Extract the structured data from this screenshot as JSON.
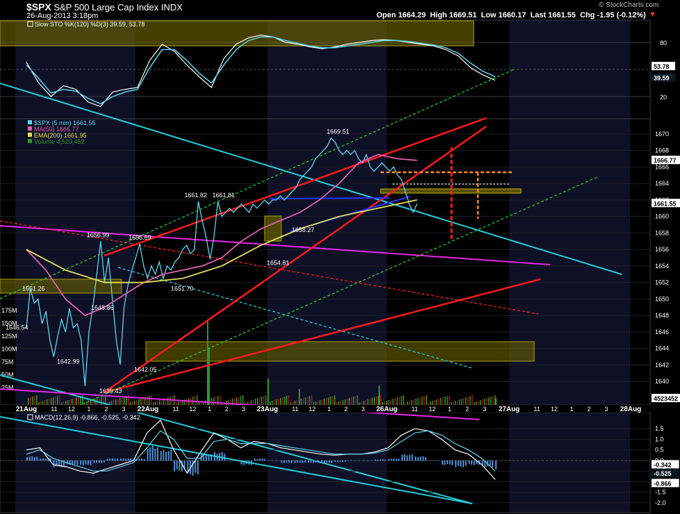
{
  "header": {
    "symbol": "$SPX",
    "name": "S&P 500 Large Cap Index",
    "exchange": "INDX",
    "datetime": "26-Aug-2013 3:18pm",
    "open_label": "Open",
    "open": "1664.29",
    "high_label": "High",
    "high": "1669.51",
    "low_label": "Low",
    "low": "1660.17",
    "last_label": "Last",
    "last": "1661.55",
    "chg_label": "Chg",
    "chg": "-1.95 (-0.12%)",
    "watermark": "© StockCharts.com"
  },
  "colors": {
    "price": "#5ad7f0",
    "ma50": "#e060b0",
    "ema200": "#e6e05a",
    "volume": "#2a9a2a",
    "trend_red": "#ff1a1a",
    "trend_cyan": "#20d0e0",
    "trend_magenta": "#ee22ee",
    "trend_green": "#22cc22",
    "zone": "#6a6200",
    "orange": "#ff8c1a",
    "blue": "#2233ff"
  },
  "chart_data": [
    {
      "type": "line",
      "panel": "sto",
      "title": "Slow STO %K(120) %D(3)",
      "legend_values": [
        "39.59",
        "53.78"
      ],
      "yticks": [
        "80",
        "20"
      ],
      "value_tags": [
        "53.78",
        "39.59"
      ],
      "ylim": [
        0,
        100
      ],
      "series": [
        {
          "name": "%K",
          "color": "#ffffff",
          "values": [
            58,
            35,
            20,
            32,
            28,
            14,
            9,
            25,
            28,
            30,
            60,
            78,
            70,
            55,
            42,
            30,
            62,
            78,
            85,
            88,
            86,
            80,
            78,
            75,
            73,
            75,
            78,
            80,
            82,
            83,
            82,
            80,
            78,
            76,
            72,
            65,
            52,
            44,
            38
          ]
        },
        {
          "name": "%D",
          "color": "#5ad7f0",
          "values": [
            55,
            40,
            24,
            28,
            26,
            18,
            12,
            20,
            25,
            28,
            52,
            72,
            72,
            60,
            46,
            35,
            55,
            72,
            82,
            86,
            86,
            82,
            79,
            76,
            74,
            74,
            76,
            78,
            80,
            82,
            82,
            81,
            79,
            77,
            74,
            68,
            57,
            48,
            42
          ]
        }
      ]
    },
    {
      "type": "line",
      "panel": "price",
      "legend": [
        {
          "text": "$SPX (5 min) 1661.55",
          "color": "#5ad7f0"
        },
        {
          "text": "MA(50) 1666.77",
          "color": "#e060b0"
        },
        {
          "text": "EMA(200) 1661.95",
          "color": "#e6e05a"
        },
        {
          "text": "Volume 4,523,452",
          "color": "#2a9a2a"
        }
      ],
      "ylim": [
        1638,
        1671
      ],
      "yticks": [
        "1670",
        "1668",
        "1666",
        "1664",
        "1662",
        "1660",
        "1658",
        "1656",
        "1654",
        "1652",
        "1650",
        "1648",
        "1646",
        "1644",
        "1642",
        "1640"
      ],
      "volume_ticks": [
        "175M",
        "150M",
        "125M",
        "100M",
        "75M",
        "50M",
        "25M"
      ],
      "value_tags": [
        "1666.77",
        "1661.55",
        "4523452"
      ],
      "annotations": [
        "1669.51",
        "1661.82",
        "1661.81",
        "1658.27",
        "1656.99",
        "1656.69",
        "1654.81",
        "1651.26",
        "1651.70",
        "1648.86",
        "1646.54",
        "1642.99",
        "1642.05",
        "1639.43"
      ],
      "series": [
        {
          "name": "$SPX",
          "x": [
            0,
            2,
            4,
            6,
            8,
            10,
            12,
            14,
            16,
            18,
            20,
            22,
            24,
            26,
            28,
            30,
            32,
            34,
            36,
            38,
            40,
            42,
            44,
            46,
            48,
            50,
            52,
            54,
            56,
            58,
            60,
            62,
            64,
            66,
            68,
            70,
            72,
            74,
            76,
            78,
            80,
            82,
            84,
            86,
            88,
            90,
            92,
            94,
            96,
            98,
            100,
            102,
            104,
            106,
            108,
            110,
            112,
            114,
            116,
            118,
            120,
            122,
            124,
            126,
            128,
            130,
            132,
            134,
            136,
            138,
            140,
            142,
            144,
            146,
            148,
            150,
            152,
            154,
            156,
            158,
            160,
            162,
            164,
            166,
            168,
            170,
            172,
            174,
            176,
            178,
            180,
            182,
            184,
            186,
            188,
            190,
            192,
            194,
            196,
            198,
            200,
            202,
            204,
            206,
            208,
            210,
            212,
            214,
            216,
            218,
            220,
            222,
            224,
            226,
            228,
            230,
            232,
            234,
            236,
            238,
            240
          ],
          "values": [
            1646.5,
            1651.3,
            1649.5,
            1650.0,
            1647.0,
            1648.5,
            1645.0,
            1642.99,
            1645.5,
            1647.5,
            1646.0,
            1648.86,
            1646.5,
            1647.0,
            1645.0,
            1639.43,
            1646.0,
            1649.0,
            1653.0,
            1656.99,
            1652.0,
            1655.0,
            1650.0,
            1645.0,
            1642.05,
            1649.0,
            1651.7,
            1653.5,
            1655.0,
            1656.69,
            1654.0,
            1652.5,
            1654.0,
            1653.0,
            1654.5,
            1652.5,
            1654.0,
            1653.5,
            1654.5,
            1655.0,
            1656.0,
            1656.5,
            1655.5,
            1656.0,
            1661.82,
            1659.5,
            1657.5,
            1654.81,
            1657.5,
            1661.81,
            1660.0,
            1660.5,
            1661.0,
            1660.5,
            1661.0,
            1661.5,
            1661.0,
            1660.5,
            1661.5,
            1661.0,
            1661.5,
            1662.0,
            1661.5,
            1662.0,
            1662.0,
            1662.5,
            1662.0,
            1662.5,
            1663.0,
            1663.5,
            1664.5,
            1665.0,
            1665.5,
            1666.0,
            1667.0,
            1667.5,
            1668.0,
            1668.5,
            1669.51,
            1669.0,
            1668.0,
            1667.5,
            1668.0,
            1667.5,
            1668.0,
            1667.0,
            1666.5,
            1667.5,
            1666.0,
            1665.5,
            1666.0,
            1666.5,
            1666.0,
            1665.5,
            1666.0,
            1665.0,
            1664.5,
            1663.0,
            1661.5,
            1660.5,
            1661.55,
            1661.55,
            1661.55,
            1661.55,
            1661.55,
            1661.55,
            1661.55,
            1661.55,
            1661.55,
            1661.55,
            1661.55,
            1661.55,
            1661.55,
            1661.55,
            1661.55,
            1661.55,
            1661.55,
            1661.55,
            1661.55,
            1661.55,
            1661.55
          ]
        },
        {
          "name": "MA(50)",
          "x": [
            0,
            10,
            20,
            30,
            40,
            50,
            60,
            70,
            80,
            90,
            100,
            110,
            120,
            130,
            140,
            150,
            160,
            170,
            180,
            190,
            200
          ],
          "values": [
            1656.0,
            1653.5,
            1650.0,
            1648.0,
            1649.0,
            1650.5,
            1652.0,
            1653.0,
            1653.5,
            1654.0,
            1655.0,
            1657.0,
            1658.5,
            1659.5,
            1660.5,
            1662.0,
            1664.0,
            1666.5,
            1667.5,
            1667.0,
            1666.8
          ]
        },
        {
          "name": "EMA(200)",
          "x": [
            0,
            20,
            40,
            60,
            80,
            100,
            120,
            140,
            160,
            180,
            200
          ],
          "values": [
            1656.0,
            1653.5,
            1652.0,
            1652.0,
            1652.5,
            1654.0,
            1656.5,
            1658.5,
            1660.0,
            1661.0,
            1662.0
          ]
        }
      ]
    },
    {
      "type": "line",
      "panel": "macd",
      "title": "MACD(12,26,9)",
      "legend_values": [
        "-0.866",
        "-0.525",
        "-0.342"
      ],
      "yticks": [
        "1.5",
        "1.0",
        "0.5",
        "0.0",
        "-0.5",
        "-1.0",
        "-1.5",
        "-2.0"
      ],
      "value_tags": [
        "-0.342",
        "-0.525",
        "-0.866"
      ],
      "ylim": [
        -2.2,
        2.0
      ],
      "series": [
        {
          "name": "MACD",
          "color": "#ffffff",
          "values": [
            0.5,
            0.6,
            -0.2,
            -0.3,
            -0.5,
            -0.6,
            -0.4,
            -0.2,
            0.0,
            1.3,
            1.9,
            0.5,
            -0.6,
            0.4,
            1.3,
            1.0,
            0.6,
            0.9,
            0.8,
            0.6,
            0.5,
            0.4,
            0.3,
            0.25,
            0.3,
            0.3,
            0.4,
            0.6,
            1.2,
            1.5,
            1.4,
            1.0,
            0.5,
            0.3,
            -0.2,
            -0.9
          ]
        },
        {
          "name": "Signal",
          "color": "#5ad7f0",
          "values": [
            0.3,
            0.5,
            0.1,
            -0.1,
            -0.3,
            -0.5,
            -0.5,
            -0.3,
            -0.1,
            0.6,
            1.4,
            1.0,
            0.1,
            0.1,
            0.9,
            1.0,
            0.8,
            0.8,
            0.8,
            0.7,
            0.6,
            0.5,
            0.4,
            0.3,
            0.3,
            0.3,
            0.35,
            0.5,
            0.9,
            1.3,
            1.4,
            1.2,
            0.8,
            0.5,
            0.1,
            -0.5
          ]
        },
        {
          "name": "Histogram",
          "color": "#4a90d9",
          "values": [
            0.2,
            0.1,
            -0.3,
            -0.2,
            -0.2,
            -0.1,
            0.1,
            0.1,
            0.1,
            0.7,
            0.5,
            -0.5,
            -0.7,
            0.3,
            0.4,
            0.0,
            -0.2,
            0.1,
            0.0,
            -0.1,
            -0.1,
            -0.1,
            -0.1,
            -0.05,
            0.0,
            0.0,
            0.05,
            0.1,
            0.3,
            0.2,
            0.0,
            -0.2,
            -0.3,
            -0.2,
            -0.3,
            -0.4
          ]
        }
      ]
    }
  ],
  "x_axis": {
    "labels": [
      {
        "text": "21Aug",
        "bold": true
      },
      {
        "text": "11"
      },
      {
        "text": "12"
      },
      {
        "text": "1"
      },
      {
        "text": "2"
      },
      {
        "text": "3"
      },
      {
        "text": "22Aug",
        "bold": true
      },
      {
        "text": "11"
      },
      {
        "text": "12"
      },
      {
        "text": "1"
      },
      {
        "text": "2"
      },
      {
        "text": "3"
      },
      {
        "text": "23Aug",
        "bold": true
      },
      {
        "text": "11"
      },
      {
        "text": "12"
      },
      {
        "text": "1"
      },
      {
        "text": "2"
      },
      {
        "text": "3"
      },
      {
        "text": "26Aug",
        "bold": true
      },
      {
        "text": "11"
      },
      {
        "text": "12"
      },
      {
        "text": "1"
      },
      {
        "text": "2"
      },
      {
        "text": "3"
      },
      {
        "text": "27Aug",
        "bold": true
      },
      {
        "text": "11"
      },
      {
        "text": "12"
      },
      {
        "text": "1"
      },
      {
        "text": "2"
      },
      {
        "text": "3"
      },
      {
        "text": "28Aug",
        "bold": true
      }
    ]
  }
}
